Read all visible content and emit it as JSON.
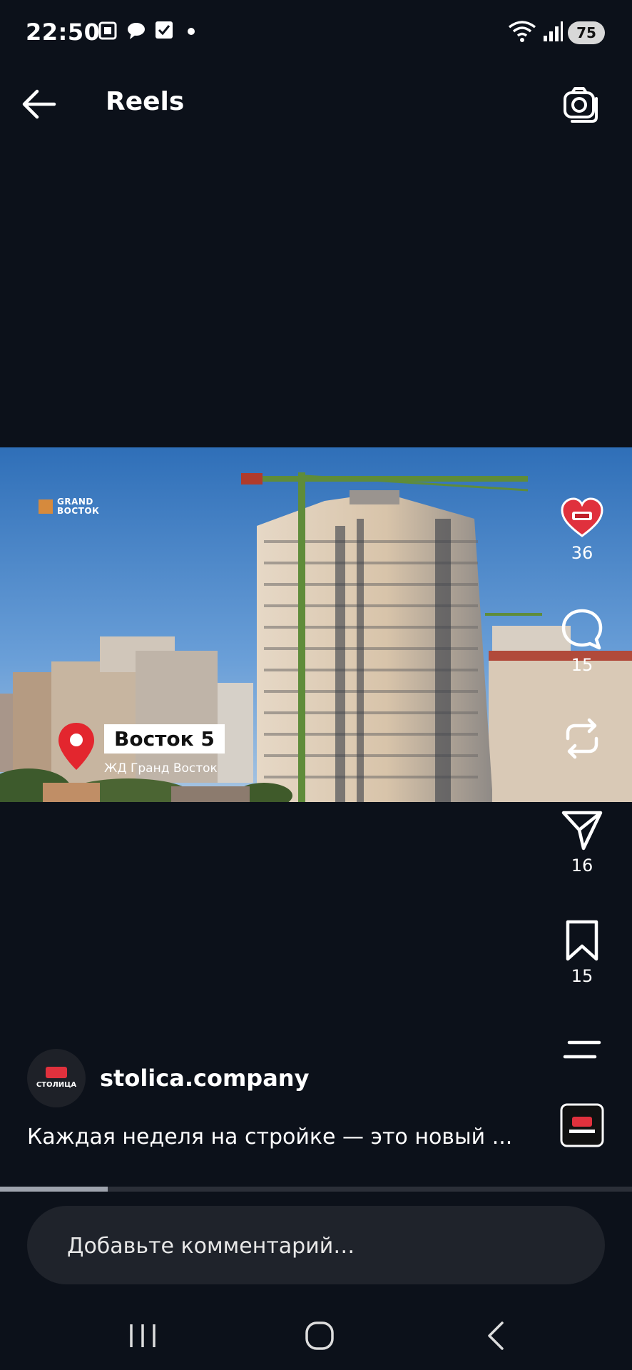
{
  "status_bar": {
    "time": "22:50",
    "battery": "75"
  },
  "header": {
    "title": "Reels"
  },
  "video": {
    "brand_line1": "GRAND",
    "brand_line2": "ВОСТОК",
    "location_title": "Восток 5",
    "location_subtitle": "ЖД Гранд Восток",
    "progress": 0.17
  },
  "actions": {
    "like_count": "36",
    "comment_count": "15",
    "share_count": "16",
    "save_count": "15"
  },
  "channel": {
    "handle": "stolica.company",
    "avatar_text": "СТОЛИЦА"
  },
  "caption": "Каждая неделя на стройке — это новый ...",
  "comment": {
    "placeholder": "Добавьте комментарий…"
  },
  "colors": {
    "background": "#0c111a",
    "like_red": "#e0313d",
    "pin_red": "#e3262e"
  }
}
